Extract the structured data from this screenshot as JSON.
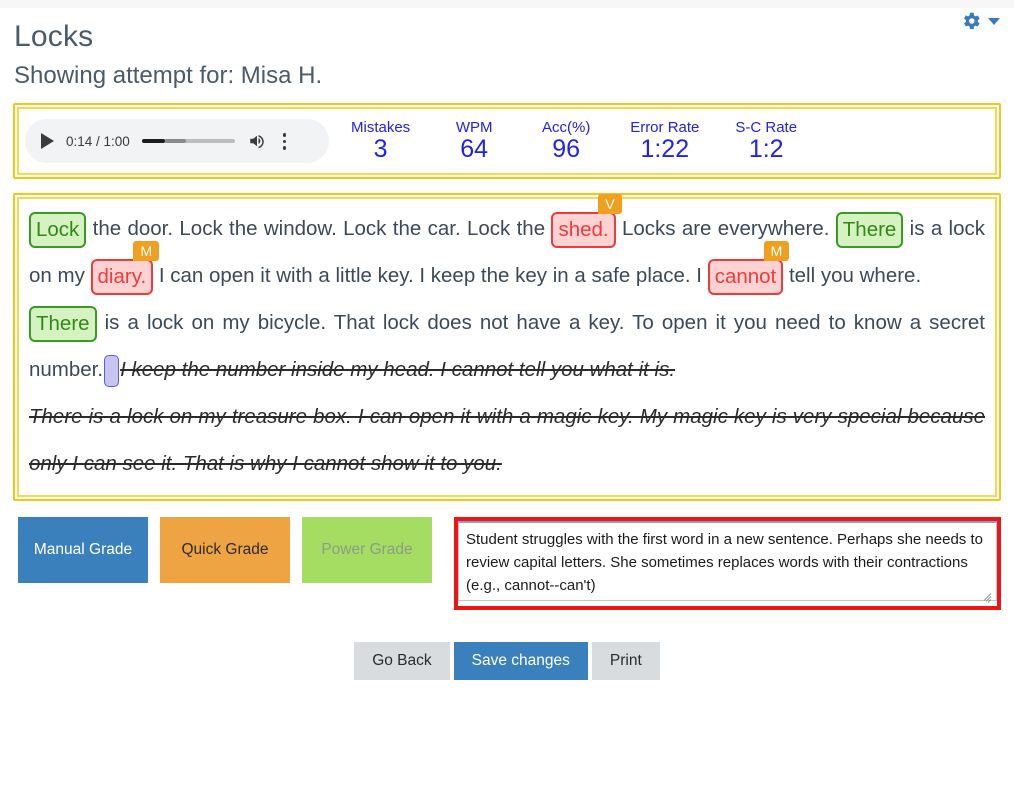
{
  "header": {
    "title": "Locks",
    "subtitle": "Showing attempt for: Misa H.",
    "gear_icon": "gear-icon",
    "caret_icon": "chevron-down-icon",
    "accent": "#3a7bbf"
  },
  "audio": {
    "play_icon": "play-icon",
    "time": "0:14 / 1:00",
    "volume_icon": "volume-icon",
    "menu_icon": "kebab-menu-icon",
    "progress_percent": 25
  },
  "stats": [
    {
      "label": "Mistakes",
      "value": "3"
    },
    {
      "label": "WPM",
      "value": "64"
    },
    {
      "label": "Acc(%)",
      "value": "96"
    },
    {
      "label": "Error Rate",
      "value": "1:22"
    },
    {
      "label": "S-C Rate",
      "value": "1:2"
    }
  ],
  "stats_color": "#2222ee",
  "passage": {
    "p1": {
      "w1": "Lock",
      "t1": " the door. Lock the window. Lock the car. Lock the ",
      "w2": "shed.",
      "w2_badge": "V",
      "t2": " Locks are everywhere. ",
      "w3": "There",
      "t3": " is a lock on my ",
      "w4": "diary.",
      "w4_badge": "M",
      "t4": " I can open it with a little key. I keep the key in a safe place. I ",
      "w5": "cannot",
      "w5_badge": "M",
      "t5": " tell you where."
    },
    "p2": {
      "w1": "There",
      "t1": " is a lock on my bicycle. That lock does not have a key. To open it you need to know a secret number.",
      "struck": "I keep the number inside my head. I cannot tell you what it is."
    },
    "p3": {
      "struck": "There is a lock on my treasure box. I can open it with a magic key. My magic key is very special because only I can see it. That is why I cannot show it to you."
    }
  },
  "grade_buttons": [
    {
      "label": "Manual Grade",
      "style": "manual"
    },
    {
      "label": "Quick Grade",
      "style": "quick"
    },
    {
      "label": "Power Grade",
      "style": "power"
    }
  ],
  "note": {
    "value": "Student struggles with the first word in a new sentence. Perhaps she needs to review capital letters. She sometimes replaces words with their contractions (e.g., cannot--can't)",
    "placeholder": "",
    "border_color": "#f01414"
  },
  "footer": [
    {
      "label": "Go Back",
      "style": "sec"
    },
    {
      "label": "Save changes",
      "style": "pri"
    },
    {
      "label": "Print",
      "style": "sec"
    }
  ],
  "colors": {
    "panel_border": "#f5c518",
    "green_highlight_bg": "#d6f2c3",
    "green_highlight_fg": "#2e8b12",
    "red_highlight_bg": "#fcd2d2",
    "red_highlight_fg": "#ef3b3b",
    "badge_bg": "#f0a020"
  }
}
